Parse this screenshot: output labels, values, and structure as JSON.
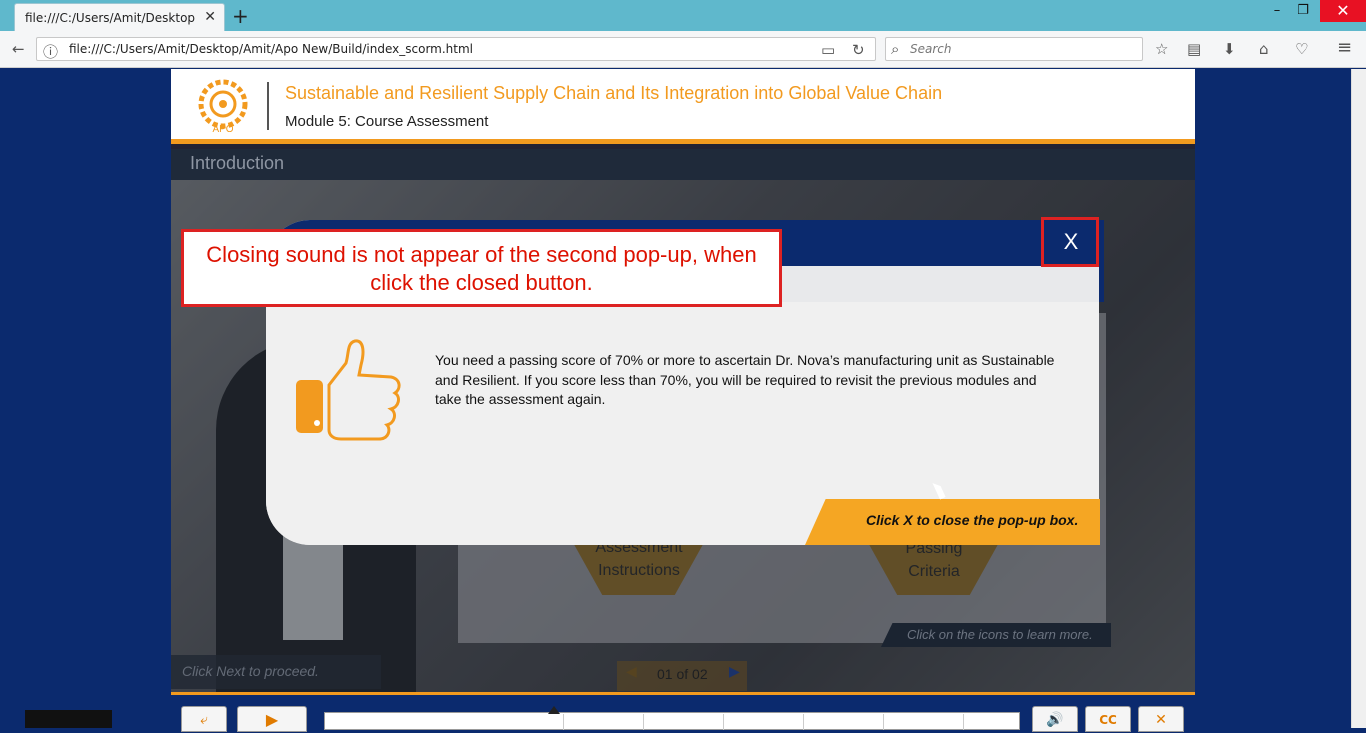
{
  "browser": {
    "tab_title": "file:///C:/Users/Amit/Desktop/A",
    "tab_close": "✕",
    "new_tab": "+",
    "url": "file:///C:/Users/Amit/Desktop/Amit/Apo New/Build/index_scorm.html",
    "search_placeholder": "Search",
    "window": {
      "minimize": "–",
      "restore": "❐",
      "close": "✕"
    },
    "icons": {
      "back": "←",
      "info": "ⓘ",
      "reader": "▭",
      "reload": "↻",
      "search": "⌕",
      "star": "☆",
      "library": "▤",
      "download": "⬇",
      "home": "⌂",
      "pocket": "♡",
      "menu": "≡"
    }
  },
  "course": {
    "title": "Sustainable and Resilient Supply Chain and Its Integration into Global Value Chain",
    "module": "Module 5: Course Assessment",
    "logo_text": "APO",
    "section": "Introduction",
    "proceed_hint": "Click Next to proceed.",
    "background_panel": {
      "hex1_label": "Assessment\nInstructions",
      "hex2_label": "Passing\nCriteria",
      "hint": "Click on the icons to learn more."
    },
    "pager": {
      "text": "01 of 02",
      "prev": "◀",
      "next": "▶"
    }
  },
  "popup": {
    "close_label": "X",
    "body": "You need a passing score of 70% or more to ascertain Dr. Nova’s manufacturing unit as Sustainable and Resilient. If you score less than 70%, you will be required to revisit the previous modules and take the assessment again.",
    "hint": "Click X to close the pop-up box."
  },
  "annotation": {
    "text": "Closing sound is not appear of the second pop-up, when click the closed button."
  },
  "controls": {
    "exit": "⤶",
    "play": "▶",
    "volume": "🔊",
    "cc": "CC",
    "close": "✕",
    "progress": 0.33
  },
  "colors": {
    "brand_orange": "#f29a1f",
    "navy": "#0b2a6e",
    "annotation_red": "#dd2222"
  }
}
